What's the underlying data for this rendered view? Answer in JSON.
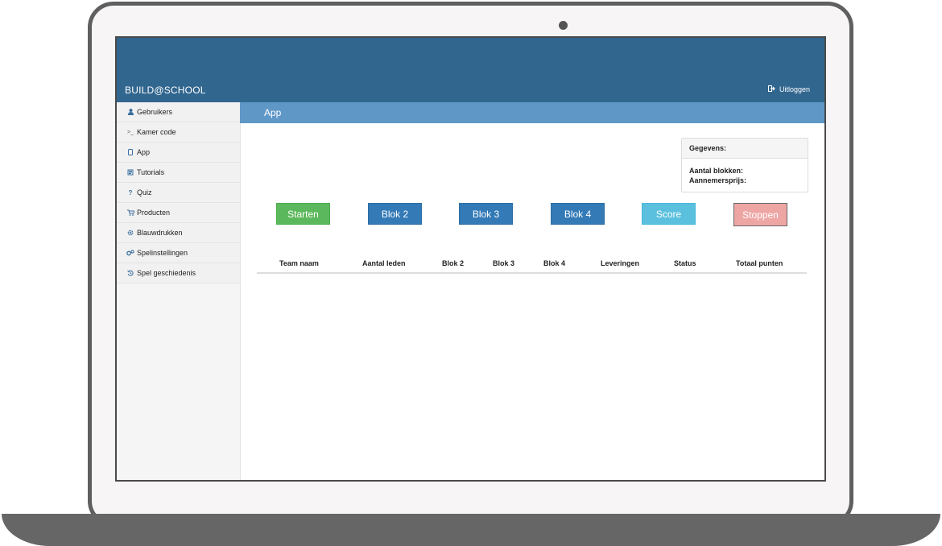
{
  "header": {
    "brand": "BUILD@SCHOOL",
    "logout_label": "Uitloggen"
  },
  "sidebar": {
    "items": [
      {
        "icon": "user-icon",
        "label": "Gebruikers"
      },
      {
        "icon": "terminal-icon",
        "label": "Kamer code"
      },
      {
        "icon": "tablet-icon",
        "label": "App"
      },
      {
        "icon": "book-icon",
        "label": "Tutorials"
      },
      {
        "icon": "question-icon",
        "label": "Quiz"
      },
      {
        "icon": "cart-icon",
        "label": "Producten"
      },
      {
        "icon": "gear-icon",
        "label": "Blauwdrukken"
      },
      {
        "icon": "gears-icon",
        "label": "Spelinstellingen"
      },
      {
        "icon": "history-icon",
        "label": "Spel geschiedenis"
      }
    ]
  },
  "page": {
    "title": "App"
  },
  "panel": {
    "heading": "Gegevens:",
    "blocks_label": "Aantal blokken:",
    "price_label": "Aannemersprijs:"
  },
  "buttons": {
    "start": "Starten",
    "block2": "Blok 2",
    "block3": "Blok 3",
    "block4": "Blok 4",
    "score": "Score",
    "stop": "Stoppen"
  },
  "table": {
    "columns": [
      "Team naam",
      "Aantal leden",
      "Blok 2",
      "Blok 3",
      "Blok 4",
      "Leveringen",
      "Status",
      "Totaal punten"
    ],
    "rows": []
  },
  "colors": {
    "header_bg": "#31668f",
    "subbar_bg": "#5f97c7",
    "success": "#5cb85c",
    "primary": "#337ab7",
    "info": "#5bc0de",
    "danger_light": "#eea6a5"
  }
}
